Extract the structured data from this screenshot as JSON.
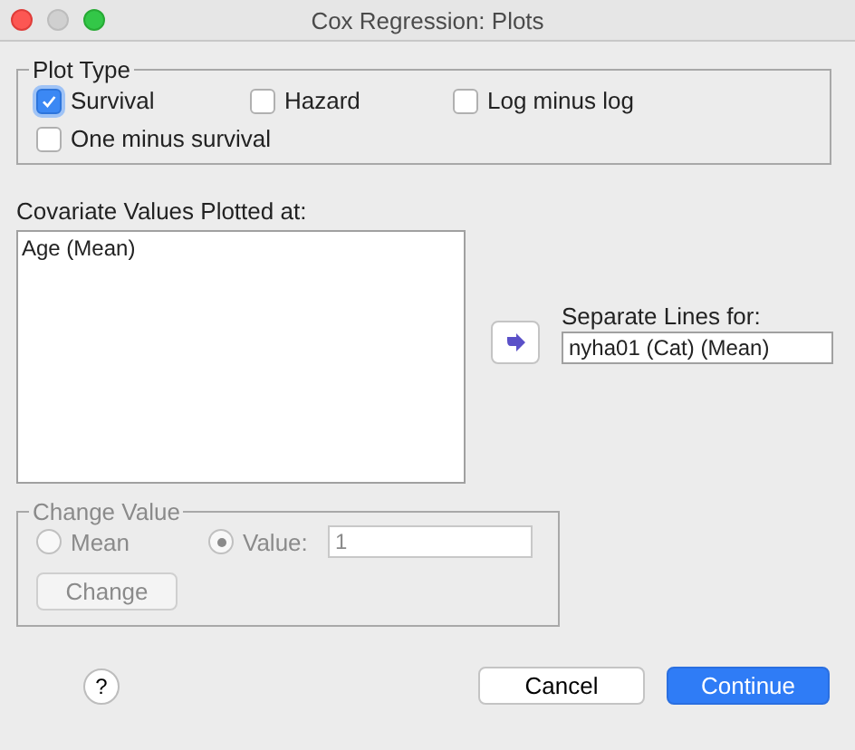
{
  "window": {
    "title": "Cox Regression: Plots"
  },
  "plot_type": {
    "title": "Plot Type",
    "options": [
      {
        "label": "Survival",
        "checked": true
      },
      {
        "label": "Hazard",
        "checked": false
      },
      {
        "label": "Log minus log",
        "checked": false
      },
      {
        "label": "One minus survival",
        "checked": false
      }
    ]
  },
  "covariates": {
    "label": "Covariate Values Plotted at:",
    "items": [
      "Age (Mean)"
    ]
  },
  "separate_lines": {
    "label": "Separate Lines for:",
    "value": "nyha01 (Cat) (Mean)"
  },
  "change_value": {
    "title": "Change Value",
    "disabled": true,
    "options": [
      {
        "label": "Mean",
        "selected": false
      },
      {
        "label": "Value:",
        "selected": true
      }
    ],
    "value": "1",
    "button": "Change"
  },
  "buttons": [
    {
      "label": "?",
      "kind": "help"
    },
    {
      "label": "Cancel",
      "kind": "default"
    },
    {
      "label": "Continue",
      "kind": "primary"
    }
  ]
}
